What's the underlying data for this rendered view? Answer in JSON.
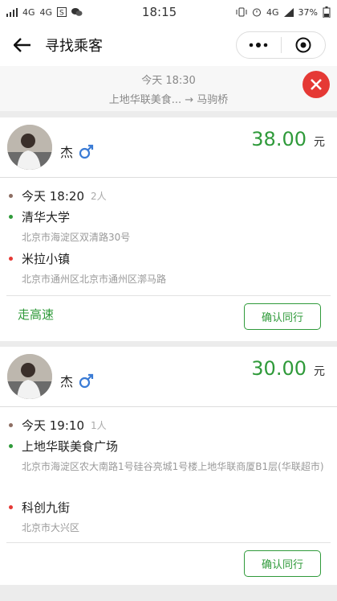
{
  "status": {
    "left_signals": [
      "4G",
      "4G"
    ],
    "time": "18:15",
    "network": "4G",
    "battery": "37%"
  },
  "nav": {
    "title": "寻找乘客"
  },
  "route": {
    "time": "今天 18:30",
    "from_to": "上地华联美食... → 马驹桥"
  },
  "trips": [
    {
      "name": "杰",
      "price": "38.00",
      "currency": "元",
      "time": "今天 18:20",
      "seats": "2人",
      "pickup": "清华大学",
      "pickup_addr": "北京市海淀区双清路30号",
      "dropoff": "米拉小镇",
      "dropoff_addr": "北京市通州区北京市通州区漷马路",
      "tag": "走高速",
      "action": "确认同行"
    },
    {
      "name": "杰",
      "price": "30.00",
      "currency": "元",
      "time": "今天 19:10",
      "seats": "1人",
      "pickup": "上地华联美食广场",
      "pickup_addr": "北京市海淀区农大南路1号硅谷亮城1号楼上地华联商厦B1层(华联超市)",
      "dropoff": "科创九街",
      "dropoff_addr": "北京市大兴区",
      "tag": "",
      "action": "确认同行"
    }
  ],
  "colors": {
    "accent": "#2f9a3a",
    "pickup_dot": "#2f9a3a",
    "dropoff_dot": "#e53935",
    "time_dot": "#8d6e63",
    "close": "#e53935"
  },
  "icons": [
    "back-arrow-icon",
    "more-dots-icon",
    "target-icon",
    "close-icon",
    "male-icon"
  ]
}
